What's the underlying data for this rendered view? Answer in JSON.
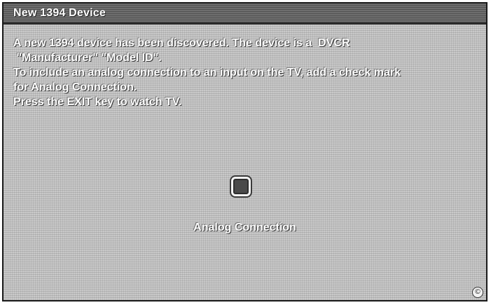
{
  "dialog": {
    "title": "New 1394 Device",
    "message_lines": [
      "A new 1394 device has been discovered. The device is a  DVCR",
      " \"Manufacturer\" \"Model ID\".",
      "To include an analog connection to an input on the TV, add a check mark",
      "for Analog Connection.",
      "Press the EXIT key to watch TV."
    ],
    "checkbox": {
      "label": "Analog Connection",
      "checked": false
    },
    "corner_icon": "©"
  },
  "colors": {
    "background": "#c9c9c9",
    "title_bar": "#6e6e6e",
    "text": "#ffffff",
    "checkbox_fill": "#4a4a4a"
  }
}
